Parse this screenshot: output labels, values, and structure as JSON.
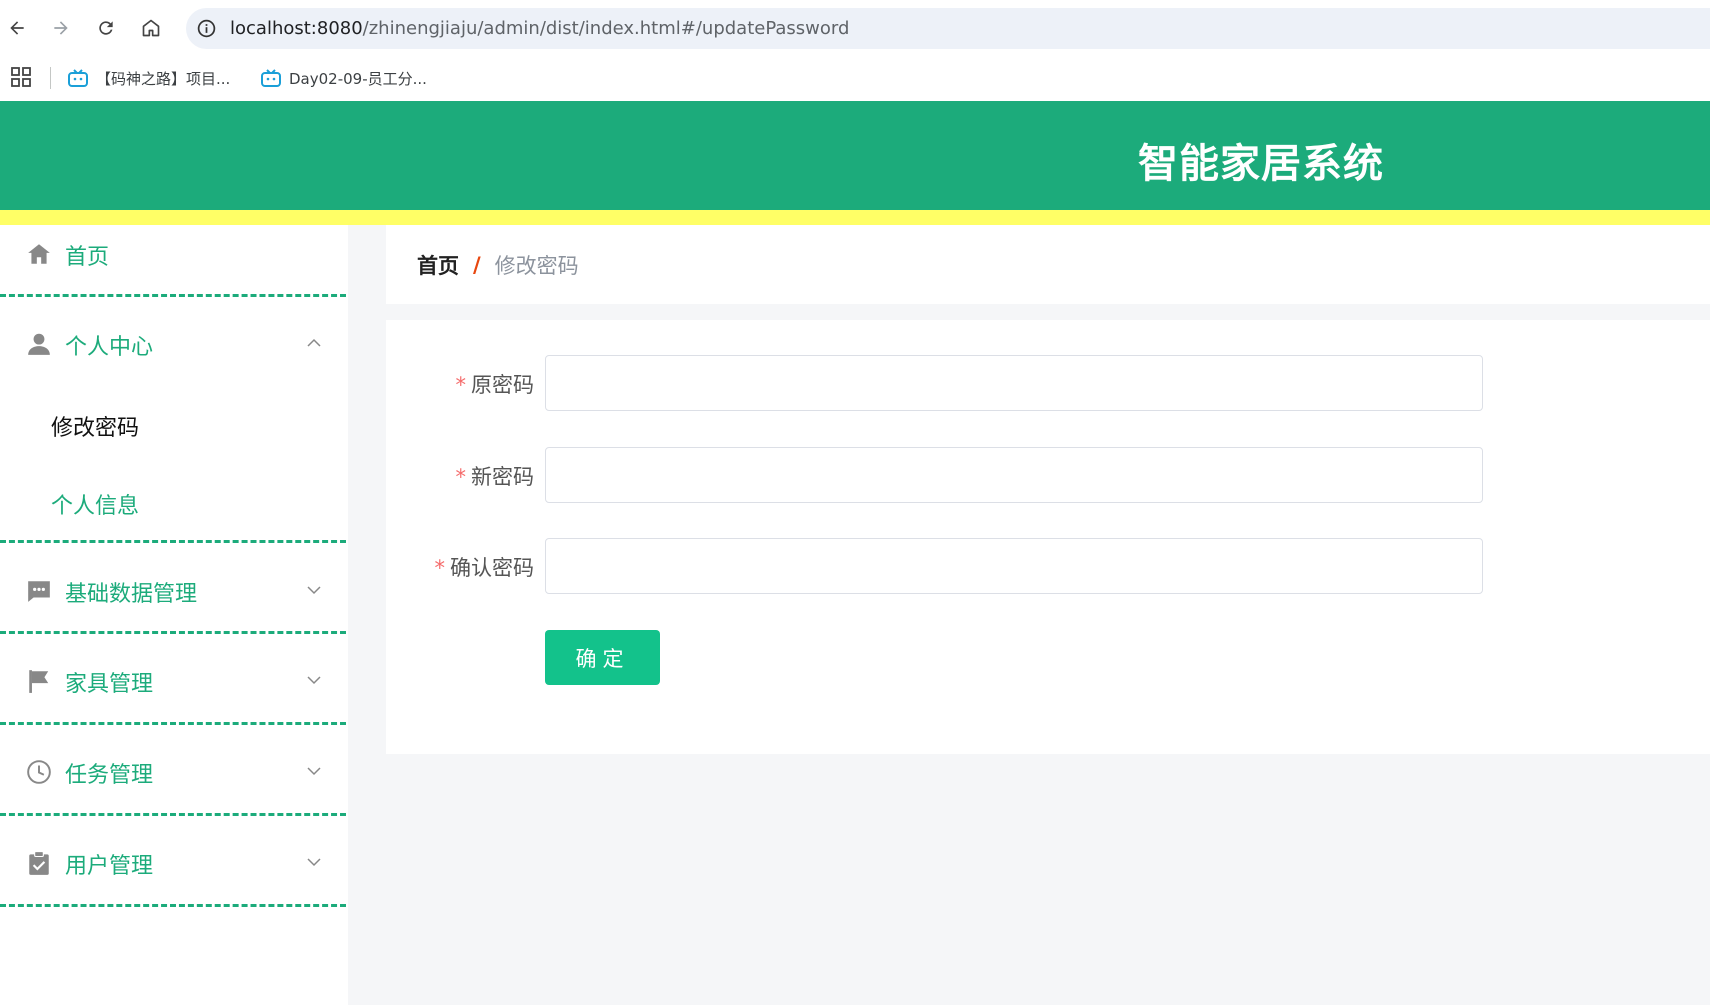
{
  "browser": {
    "url_host": "localhost:8080",
    "url_path": "/zhinengjiaju/admin/dist/index.html#/updatePassword",
    "bookmarks": [
      {
        "label": "【码神之路】项目..."
      },
      {
        "label": "Day02-09-员工分..."
      }
    ],
    "accent_color": "#1a9fd8"
  },
  "header": {
    "title": "智能家居系统",
    "background": "#1cab7b"
  },
  "sidebar": {
    "items": [
      {
        "label": "首页",
        "icon": "home-icon"
      },
      {
        "label": "个人中心",
        "icon": "user-icon",
        "expanded": true,
        "children": [
          {
            "label": "修改密码",
            "active": true
          },
          {
            "label": "个人信息",
            "active": false
          }
        ]
      },
      {
        "label": "基础数据管理",
        "icon": "message-icon"
      },
      {
        "label": "家具管理",
        "icon": "flag-icon"
      },
      {
        "label": "任务管理",
        "icon": "clock-icon"
      },
      {
        "label": "用户管理",
        "icon": "clipboard-check-icon"
      }
    ]
  },
  "breadcrumb": {
    "home": "首页",
    "separator": "/",
    "current": "修改密码"
  },
  "form": {
    "fields": [
      {
        "label": "原密码",
        "required": "*",
        "value": ""
      },
      {
        "label": "新密码",
        "required": "*",
        "value": ""
      },
      {
        "label": "确认密码",
        "required": "*",
        "value": ""
      }
    ],
    "submit_label": "确定"
  }
}
